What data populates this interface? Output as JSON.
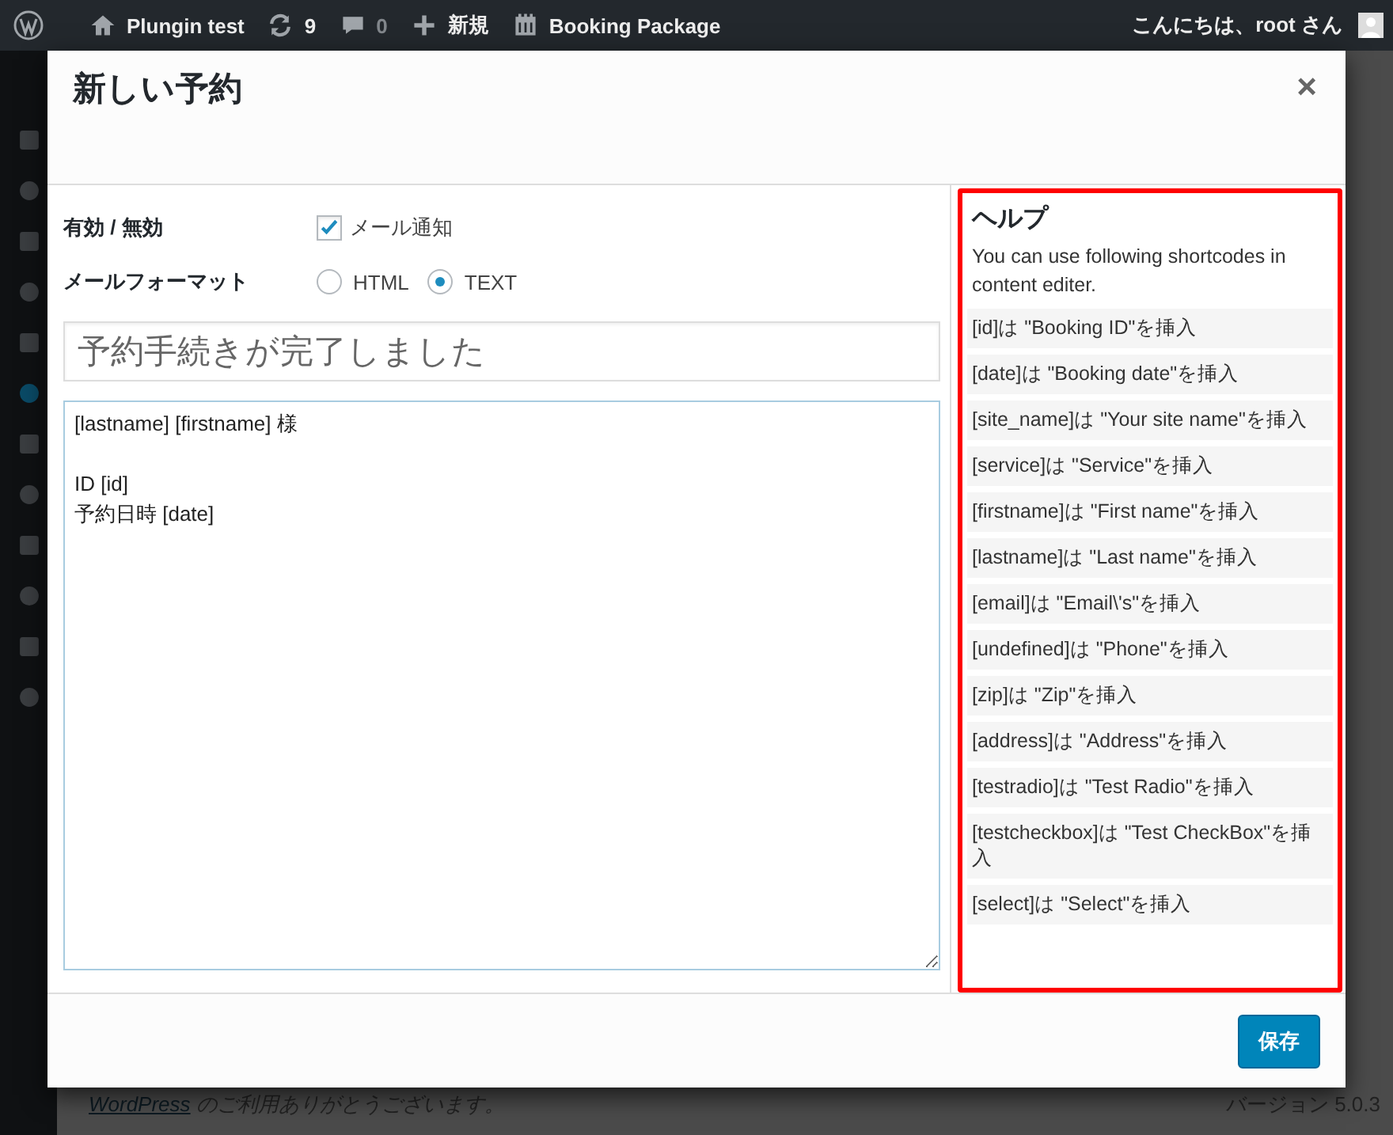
{
  "admin_bar": {
    "site": "Plungin test",
    "updates": "9",
    "comments": "0",
    "new": "新規",
    "plugin": "Booking Package",
    "greeting": "こんにちは、root さん"
  },
  "dialog": {
    "title": "新しい予約",
    "close": "×",
    "enable_row": {
      "label": "有効 / 無効",
      "checkbox": {
        "label": "メール通知",
        "checked": true
      }
    },
    "format_row": {
      "label": "メールフォーマット",
      "options": [
        {
          "label": "HTML",
          "selected": false
        },
        {
          "label": "TEXT",
          "selected": true
        }
      ]
    },
    "subject": {
      "value": "予約手続きが完了しました"
    },
    "body": {
      "value": "[lastname] [firstname] 様\n\nID [id]\n予約日時 [date]\n"
    },
    "help": {
      "title": "ヘルプ",
      "intro": "You can use following shortcodes in content editer.",
      "items": [
        "[id]は \"Booking ID\"を挿入",
        "[date]は \"Booking date\"を挿入",
        "[site_name]は \"Your site name\"を挿入",
        "[service]は \"Service\"を挿入",
        "[firstname]は \"First name\"を挿入",
        "[lastname]は \"Last name\"を挿入",
        "[email]は \"Email\\'s\"を挿入",
        "[undefined]は \"Phone\"を挿入",
        "[zip]は \"Zip\"を挿入",
        "[address]は \"Address\"を挿入",
        "[testradio]は \"Test Radio\"を挿入",
        "[testcheckbox]は \"Test CheckBox\"を挿入",
        "[select]は \"Select\"を挿入"
      ]
    },
    "save": "保存"
  },
  "footer": {
    "link": "WordPress",
    "text": " のご利用ありがとうございます。",
    "version": "バージョン 5.0.3"
  }
}
